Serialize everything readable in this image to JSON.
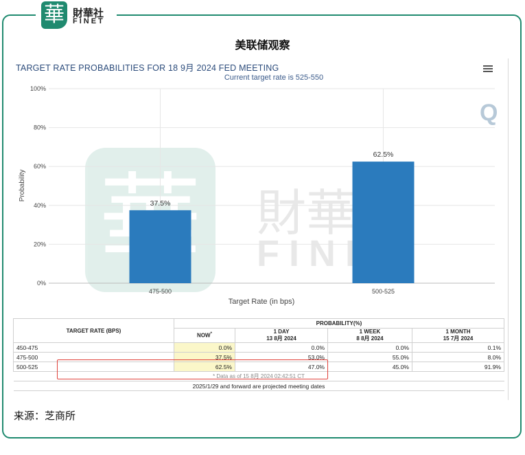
{
  "brand": {
    "seal_char": "華",
    "name_cn": "財華社",
    "name_en": "FINET"
  },
  "headline": "美联储观察",
  "chart_title": "TARGET RATE PROBABILITIES FOR 18 9月 2024 FED MEETING",
  "chart_subtitle": "Current target rate is 525-550",
  "chart_data": {
    "type": "bar",
    "categories": [
      "475-500",
      "500-525"
    ],
    "values": [
      37.5,
      62.5
    ],
    "data_labels": [
      "37.5%",
      "62.5%"
    ],
    "xlabel": "Target Rate (in bps)",
    "ylabel": "Probability",
    "ylim": [
      0,
      100
    ],
    "y_ticks": [
      "0%",
      "20%",
      "40%",
      "60%",
      "80%",
      "100%"
    ],
    "grid": true,
    "bar_color": "#2b7bbd"
  },
  "watermark": {
    "cn": "財華社",
    "en": "FINET",
    "seal": "華",
    "mark": "Q"
  },
  "table": {
    "col_target": "TARGET RATE (BPS)",
    "col_group": "PROBABILITY(%)",
    "headers": [
      {
        "l1": "NOW",
        "l2": ""
      },
      {
        "l1": "1 DAY",
        "l2": "13 8月 2024"
      },
      {
        "l1": "1 WEEK",
        "l2": "8 8月 2024"
      },
      {
        "l1": "1 MONTH",
        "l2": "15 7月 2024"
      }
    ],
    "rows": [
      {
        "rate": "450-475",
        "now": "0.0%",
        "day": "0.0%",
        "week": "0.0%",
        "month": "0.1%"
      },
      {
        "rate": "475-500",
        "now": "37.5%",
        "day": "53.0%",
        "week": "55.0%",
        "month": "8.0%"
      },
      {
        "rate": "500-525",
        "now": "62.5%",
        "day": "47.0%",
        "week": "45.0%",
        "month": "91.9%"
      }
    ],
    "note": "* Data as of 15 8月 2024 02:42:51 CT",
    "footer": "2025/1/29 and forward are projected meeting dates"
  },
  "source": "来源：芝商所"
}
